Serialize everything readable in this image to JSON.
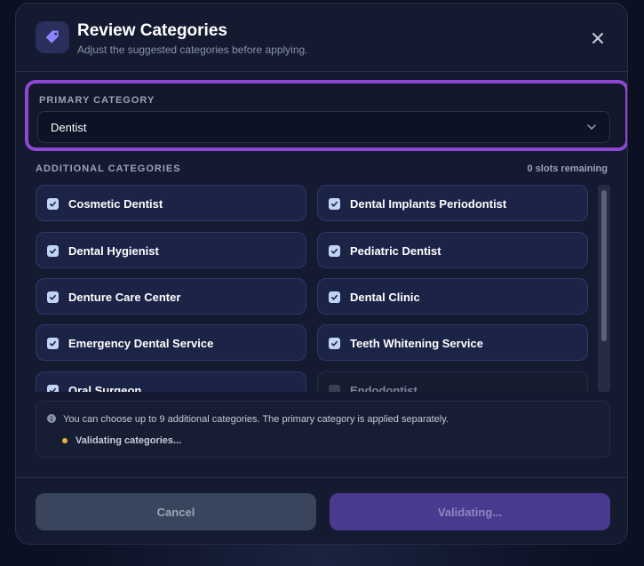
{
  "modal": {
    "title": "Review Categories",
    "subtitle": "Adjust the suggested categories before applying."
  },
  "primary": {
    "label": "PRIMARY CATEGORY",
    "value": "Dentist"
  },
  "additional": {
    "label": "ADDITIONAL CATEGORIES",
    "slots": "0 slots remaining",
    "items": [
      {
        "label": "Cosmetic Dentist",
        "checked": true
      },
      {
        "label": "Dental Implants Periodontist",
        "checked": true
      },
      {
        "label": "Dental Hygienist",
        "checked": true
      },
      {
        "label": "Pediatric Dentist",
        "checked": true
      },
      {
        "label": "Denture Care Center",
        "checked": true
      },
      {
        "label": "Dental Clinic",
        "checked": true
      },
      {
        "label": "Emergency Dental Service",
        "checked": true
      },
      {
        "label": "Teeth Whitening Service",
        "checked": true
      },
      {
        "label": "Oral Surgeon",
        "checked": true
      },
      {
        "label": "Endodontist",
        "checked": false
      }
    ]
  },
  "info": {
    "text": "You can choose up to 9 additional categories. The primary category is applied separately.",
    "status": "Validating categories..."
  },
  "buttons": {
    "cancel": "Cancel",
    "submit": "Validating..."
  },
  "colors": {
    "accent": "#8e47d2",
    "status_dot": "#e7b23a",
    "submit_bg": "#4a3a8f"
  }
}
